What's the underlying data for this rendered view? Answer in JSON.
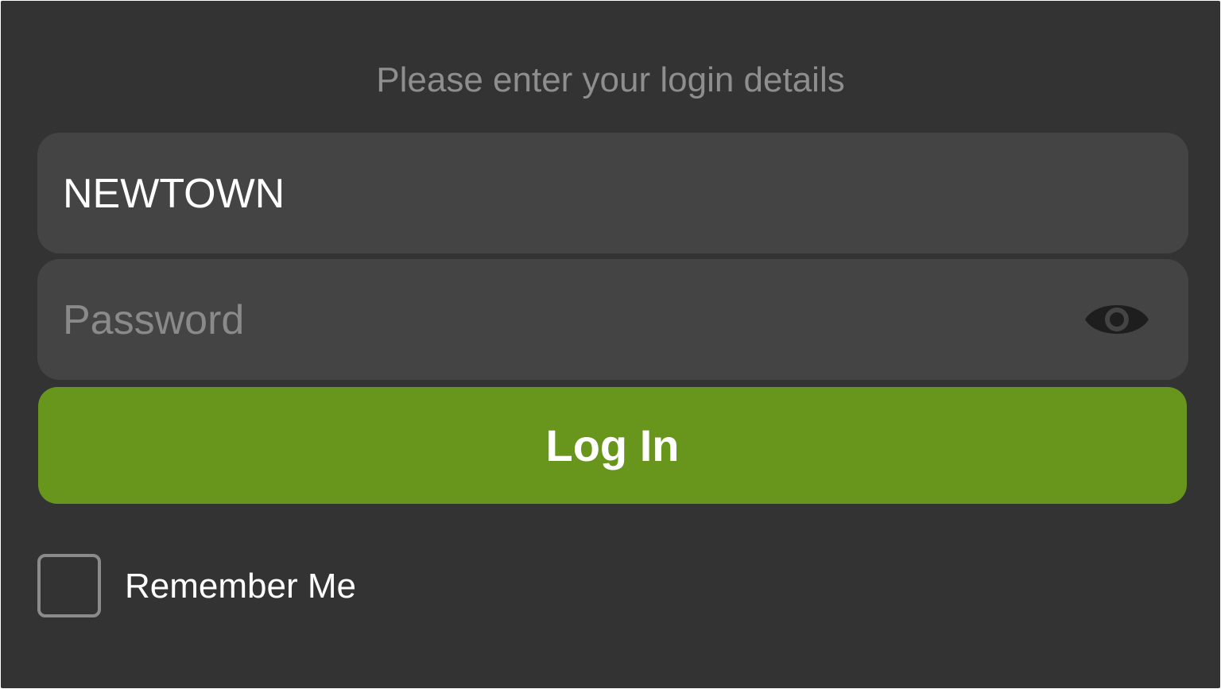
{
  "login": {
    "prompt": "Please enter your login details",
    "username_value": "NEWTOWN",
    "password_placeholder": "Password",
    "login_button_label": "Log In",
    "remember_label": "Remember Me",
    "remember_checked": false
  },
  "icons": {
    "password_toggle": "eye-icon"
  },
  "colors": {
    "background": "#333333",
    "field_background": "#444444",
    "accent_button": "#68961c",
    "prompt_text": "#8e8e8e",
    "placeholder_text": "#8a8a8a",
    "checkbox_border": "#8b8b8b"
  }
}
